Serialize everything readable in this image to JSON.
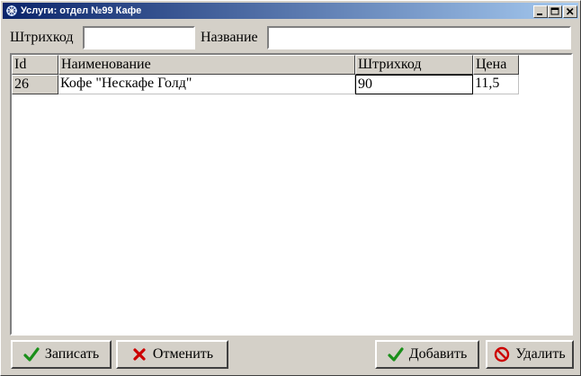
{
  "window": {
    "title": "Услуги: отдел №99 Кафе",
    "controls": {
      "minimize_icon": "minimize-icon",
      "maximize_icon": "maximize-icon",
      "close_icon": "close-icon"
    }
  },
  "filters": {
    "barcode_label": "Штрихкод",
    "barcode_value": "",
    "name_label": "Название",
    "name_value": ""
  },
  "grid": {
    "columns": [
      "Id",
      "Наименование",
      "Штрихкод",
      "Цена"
    ],
    "rows": [
      [
        "26",
        "Кофе \"Нескафе Голд\"",
        "90",
        "11,5"
      ]
    ]
  },
  "buttons": {
    "save_label": "Записать",
    "cancel_label": "Отменить",
    "add_label": "Добавить",
    "delete_label": "Удалить"
  },
  "colors": {
    "title_start": "#0a246a",
    "title_end": "#a6caf0",
    "face": "#d4d0c8",
    "check_green": "#1a8f1a",
    "cross_red": "#cc0000"
  }
}
